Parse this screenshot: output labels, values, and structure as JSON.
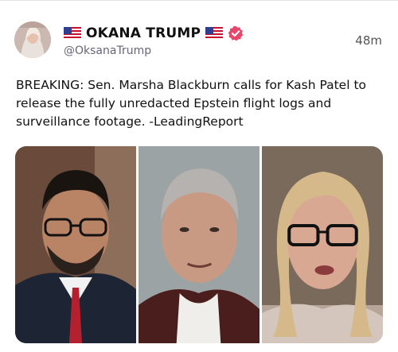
{
  "post": {
    "display_name": "OKANA TRUMP",
    "handle": "@OksanaTrump",
    "time": "48m",
    "text": "BREAKING: Sen. Marsha Blackburn calls for Kash Patel to release the fully unredacted Epstein flight logs and surveillance footage. -LeadingReport",
    "flag_icon": "us-flag-icon",
    "verified_icon": "verified-badge-icon",
    "verified_color": "#e8466a"
  },
  "media": {
    "panels": [
      "photo-left",
      "photo-center",
      "photo-right"
    ]
  }
}
